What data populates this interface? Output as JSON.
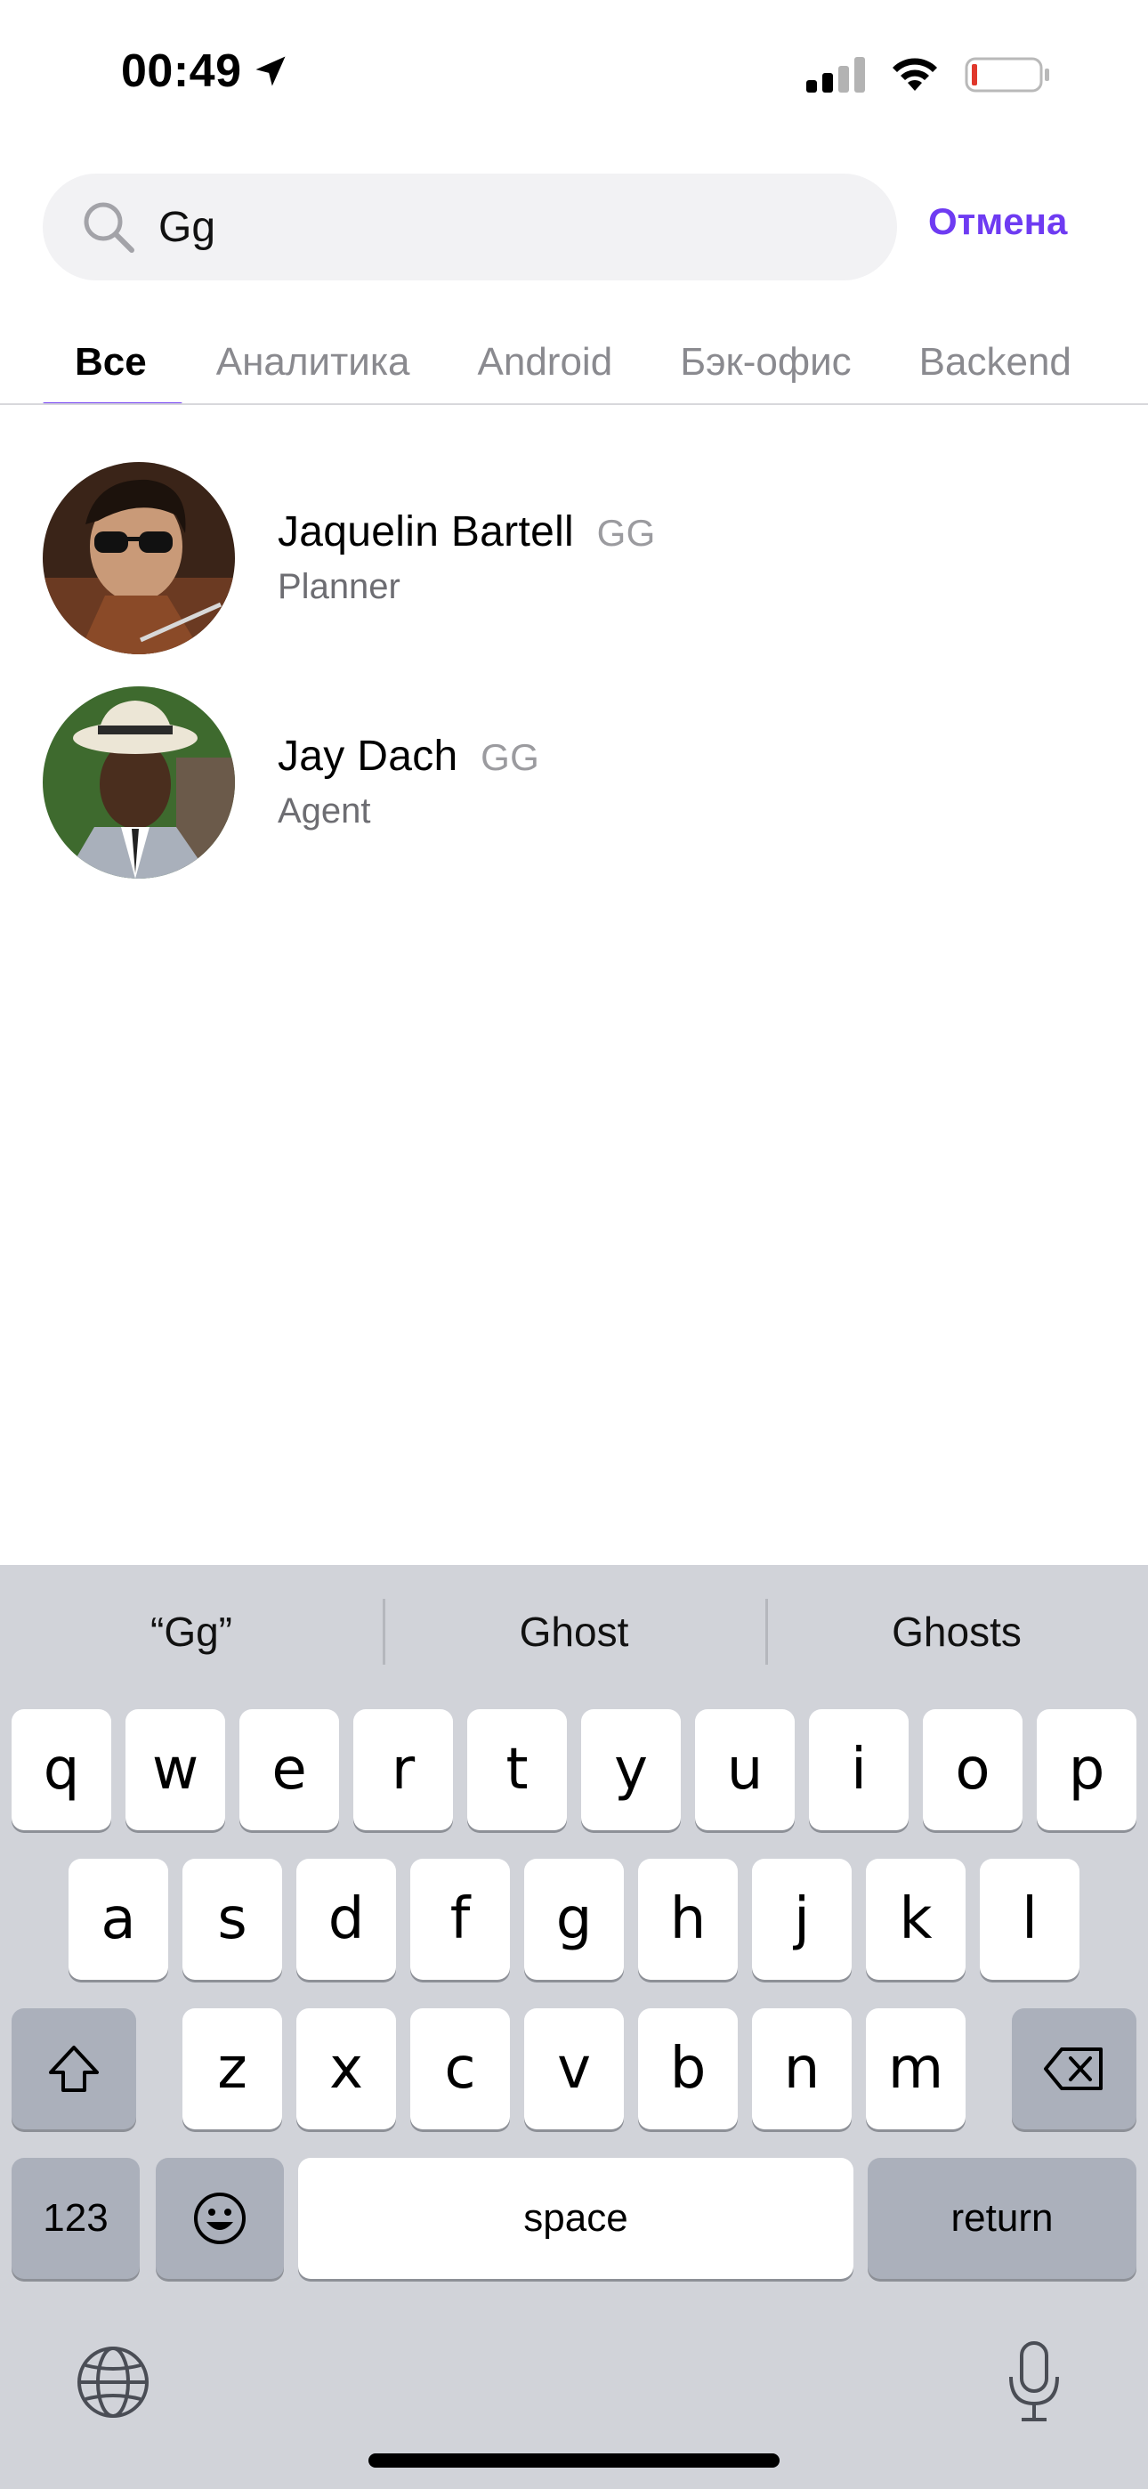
{
  "status_bar": {
    "time": "00:49",
    "location_icon": "location-arrow-icon",
    "signal_icon": "cellular-signal-icon",
    "wifi_icon": "wifi-icon",
    "battery_icon": "battery-low-icon",
    "battery_color": "#e0382c"
  },
  "search": {
    "icon": "search-icon",
    "value": "Gg",
    "cancel_label": "Отмена"
  },
  "tabs": [
    {
      "label": "Все",
      "active": true
    },
    {
      "label": "Аналитика",
      "active": false
    },
    {
      "label": "Android",
      "active": false
    },
    {
      "label": "Бэк-офис",
      "active": false
    },
    {
      "label": "Backend",
      "active": false
    }
  ],
  "results": [
    {
      "first_name": "Jaquelin",
      "last_name": "Bartell",
      "badge": "GG",
      "role": "Planner"
    },
    {
      "first_name": "Jay",
      "last_name": "Dach",
      "badge": "GG",
      "role": "Agent"
    }
  ],
  "keyboard": {
    "suggestions": [
      "“Gg”",
      "Ghost",
      "Ghosts"
    ],
    "row1": [
      "q",
      "w",
      "e",
      "r",
      "t",
      "y",
      "u",
      "i",
      "o",
      "p"
    ],
    "row2": [
      "a",
      "s",
      "d",
      "f",
      "g",
      "h",
      "j",
      "k",
      "l"
    ],
    "row3": [
      "z",
      "x",
      "c",
      "v",
      "b",
      "n",
      "m"
    ],
    "numbers_label": "123",
    "space_label": "space",
    "return_label": "return",
    "shift_icon": "shift-icon",
    "backspace_icon": "backspace-icon",
    "emoji_icon": "emoji-icon",
    "globe_icon": "globe-icon",
    "mic_icon": "microphone-icon"
  },
  "colors": {
    "accent": "#6e3bf2",
    "keyboard_bg": "#d1d3d9"
  }
}
